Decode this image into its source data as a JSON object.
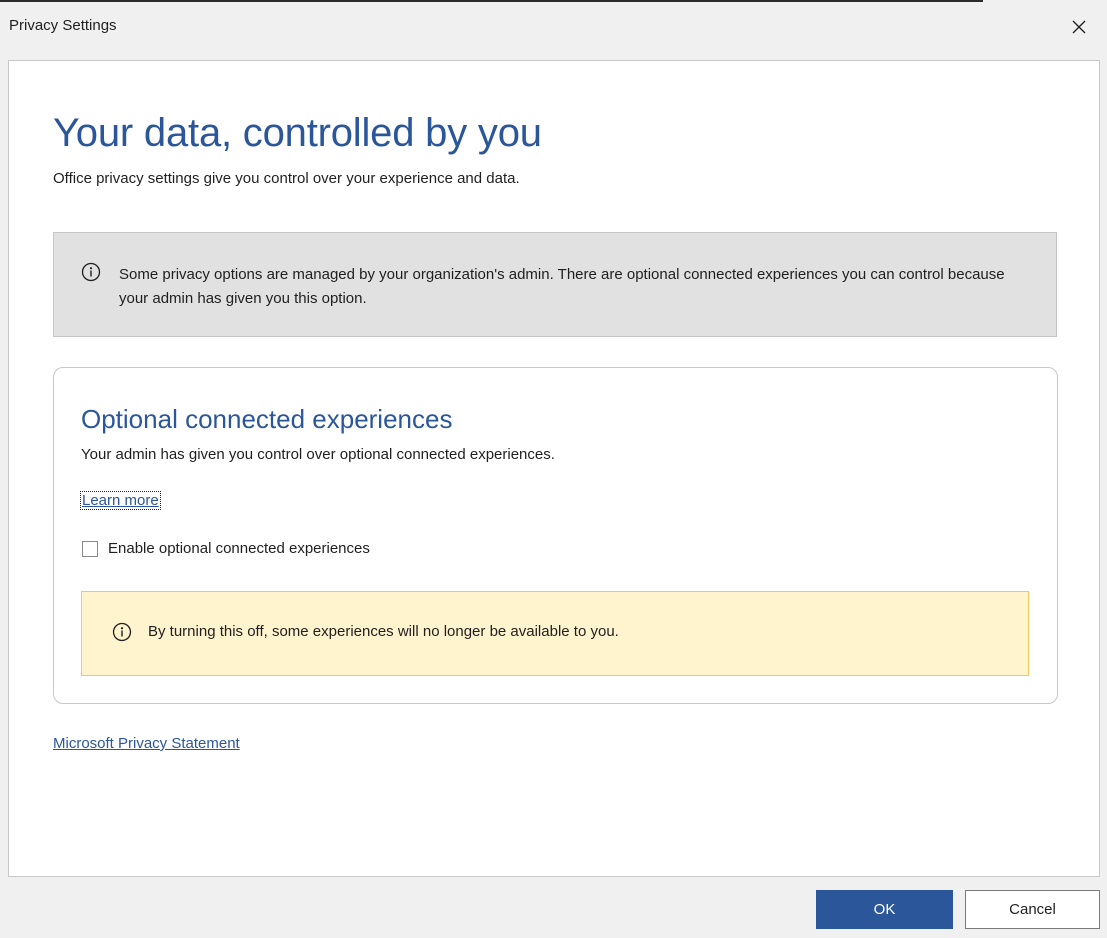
{
  "window": {
    "title": "Privacy Settings"
  },
  "main": {
    "heading": "Your data, controlled by you",
    "subtext": "Office privacy settings give you control over your experience and data.",
    "notice": {
      "icon": "info-icon",
      "text": "Some privacy options are managed by your organization's admin. There are optional connected experiences you can control because your admin has given you this option."
    },
    "optional_card": {
      "title": "Optional connected experiences",
      "description": "Your admin has given you control over optional connected experiences.",
      "learn_more": "Learn more",
      "checkbox_label": "Enable optional connected experiences",
      "checkbox_checked": false,
      "warning": {
        "icon": "info-icon",
        "text": "By turning this off, some experiences will no longer be available to you."
      }
    },
    "privacy_statement_link": "Microsoft Privacy Statement"
  },
  "footer": {
    "ok_label": "OK",
    "cancel_label": "Cancel"
  },
  "colors": {
    "accent": "#2b579a",
    "notice_bg": "#e1e1e1",
    "warning_bg": "#fff4ce",
    "warning_border": "#f2c661"
  }
}
